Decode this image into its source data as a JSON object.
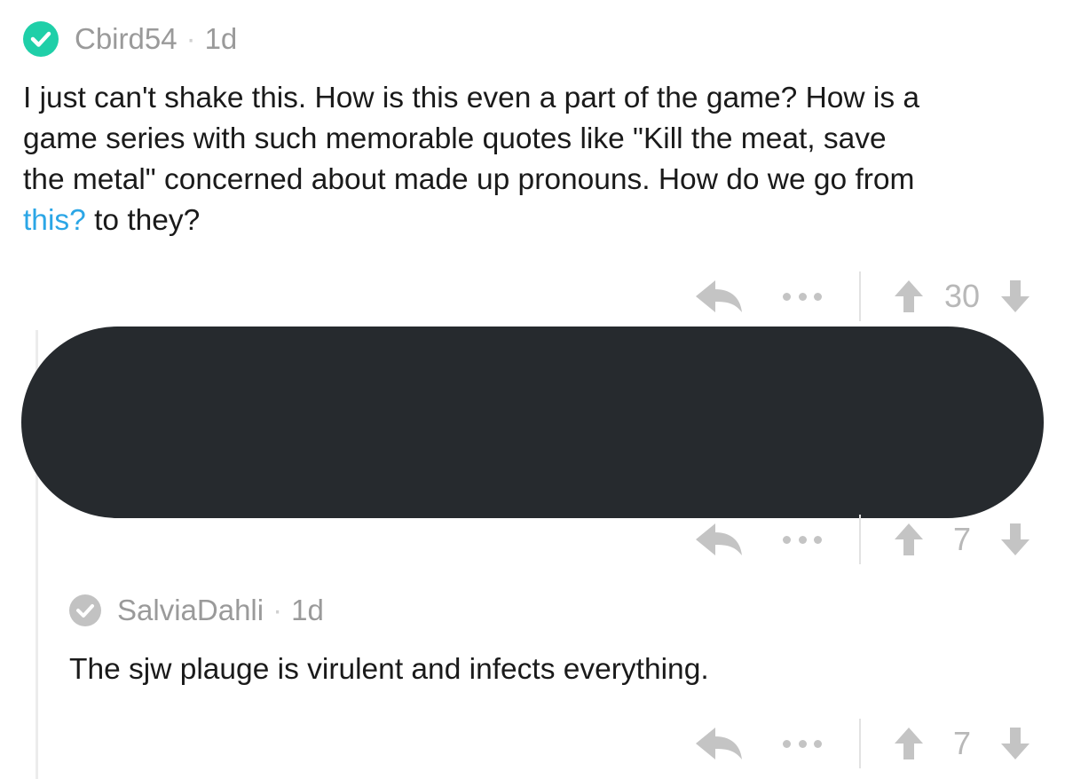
{
  "comments": [
    {
      "username": "Cbird54",
      "age": "1d",
      "badge_color": "#1fcfa8",
      "body_lines": [
        "I just can't shake this. How is this even a part of the game? How is a",
        "game series with such memorable quotes like \"Kill the meat, save",
        "the metal\" concerned about made up pronouns. How do we go from"
      ],
      "body_link": "this?",
      "body_tail": " to they?",
      "score": "30"
    },
    {
      "redacted": true,
      "score": "7"
    },
    {
      "username": "SalviaDahli",
      "age": "1d",
      "badge_color": "#c2c2c2",
      "body_lines": [
        "The sjw plauge is virulent and infects everything."
      ],
      "score": "7"
    }
  ],
  "separator": "·",
  "icons": {
    "reply": "reply-arrow-icon",
    "more": "more-dots-icon",
    "upvote": "upvote-arrow-icon",
    "downvote": "downvote-arrow-icon",
    "verified": "check-badge-icon"
  },
  "colors": {
    "link": "#2ba6e6",
    "meta_text": "#9a9a9a",
    "icon_gray": "#c4c4c4",
    "redaction": "#262a2e"
  }
}
